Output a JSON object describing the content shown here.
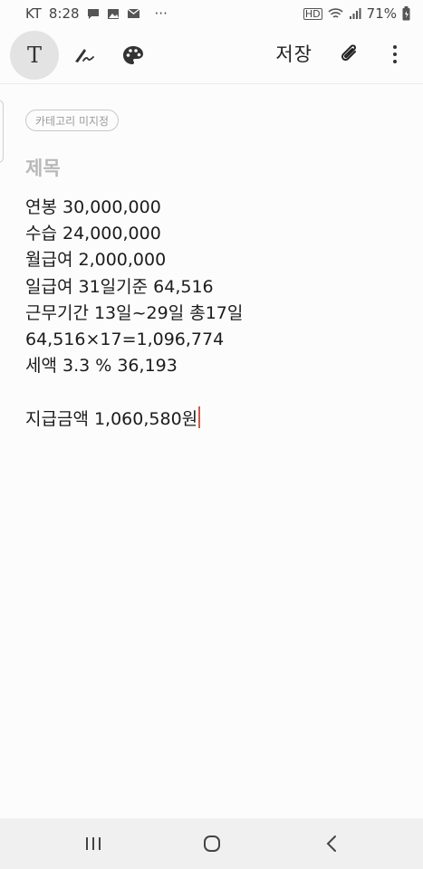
{
  "status_bar": {
    "carrier": "KT",
    "time": "8:28",
    "more_indicator": "···",
    "battery": "71%",
    "left_icons": [
      "chat-bubble-icon",
      "image-icon",
      "mail-icon"
    ],
    "right_icons": [
      "hd-icon",
      "wifi-icon",
      "signal-icon",
      "battery-icon"
    ]
  },
  "toolbar": {
    "text_tool_glyph": "T",
    "save_label": "저장",
    "icons": [
      "text-tool-icon",
      "handwriting-pen-icon",
      "palette-icon",
      "attach-clip-icon",
      "more-vert-icon"
    ]
  },
  "note": {
    "category_label": "카테고리 미지정",
    "title_placeholder": "제목",
    "lines": [
      "연봉 30,000,000",
      "수습 24,000,000",
      "월급여 2,000,000",
      "일급여 31일기준 64,516",
      "근무기간 13일~29일 총17일",
      "64,516×17=1,096,774",
      "세액 3.3 % 36,193",
      "",
      "지급금액 1,060,580원"
    ]
  },
  "colors": {
    "cursor": "#e0553d",
    "active_tool_bg": "#e3e3e3",
    "placeholder": "#b8b8b8"
  },
  "nav_bar": {
    "icons": [
      "recent-apps-icon",
      "home-icon",
      "back-icon"
    ]
  }
}
